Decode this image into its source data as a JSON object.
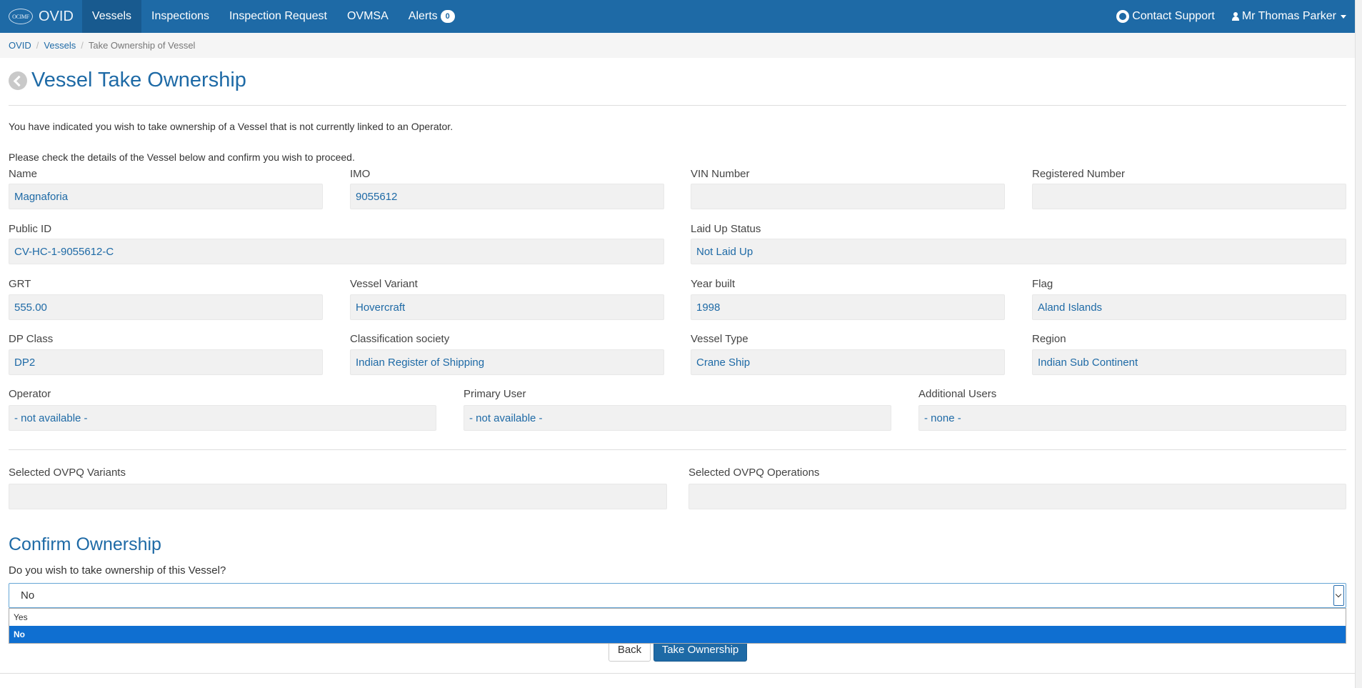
{
  "navbar": {
    "logo_text": "OCIMF",
    "brand": "OVID",
    "items": [
      {
        "label": "Vessels"
      },
      {
        "label": "Inspections"
      },
      {
        "label": "Inspection Request"
      },
      {
        "label": "OVMSA"
      },
      {
        "label": "Alerts"
      }
    ],
    "alerts_count": "0",
    "contact_support": "Contact Support",
    "user_name": "Mr Thomas Parker",
    "bg_color": "#1e6aa6"
  },
  "breadcrumb": {
    "items": [
      "OVID",
      "Vessels"
    ],
    "current": "Take Ownership of Vessel"
  },
  "page": {
    "title": "Vessel Take Ownership",
    "intro": "You have indicated you wish to take ownership of a Vessel that is not currently linked to an Operator.",
    "instruction": "Please check the details of the Vessel below and confirm you wish to proceed."
  },
  "fields": {
    "name": {
      "label": "Name",
      "value": "Magnaforia"
    },
    "imo": {
      "label": "IMO",
      "value": "9055612"
    },
    "vin": {
      "label": "VIN Number",
      "value": ""
    },
    "registered": {
      "label": "Registered Number",
      "value": ""
    },
    "public_id": {
      "label": "Public ID",
      "value": "CV-HC-1-9055612-C"
    },
    "laid_up": {
      "label": "Laid Up Status",
      "value": "Not Laid Up"
    },
    "grt": {
      "label": "GRT",
      "value": "555.00"
    },
    "variant": {
      "label": "Vessel Variant",
      "value": "Hovercraft"
    },
    "year_built": {
      "label": "Year built",
      "value": "1998"
    },
    "flag": {
      "label": "Flag",
      "value": "Aland Islands"
    },
    "dp_class": {
      "label": "DP Class",
      "value": "DP2"
    },
    "class_society": {
      "label": "Classification society",
      "value": "Indian Register of Shipping"
    },
    "vessel_type": {
      "label": "Vessel Type",
      "value": "Crane Ship"
    },
    "region": {
      "label": "Region",
      "value": "Indian Sub Continent"
    },
    "operator": {
      "label": "Operator",
      "value": "- not available -"
    },
    "primary_user": {
      "label": "Primary User",
      "value": "- not available -"
    },
    "additional_users": {
      "label": "Additional Users",
      "value": "- none -"
    },
    "ovpq_variants": {
      "label": "Selected OVPQ Variants",
      "value": ""
    },
    "ovpq_operations": {
      "label": "Selected OVPQ Operations",
      "value": ""
    }
  },
  "confirm": {
    "title": "Confirm Ownership",
    "question": "Do you wish to take ownership of this Vessel?",
    "selected": "No",
    "options": [
      "Yes",
      "No"
    ],
    "back_label": "Back",
    "take_label": "Take Ownership"
  }
}
